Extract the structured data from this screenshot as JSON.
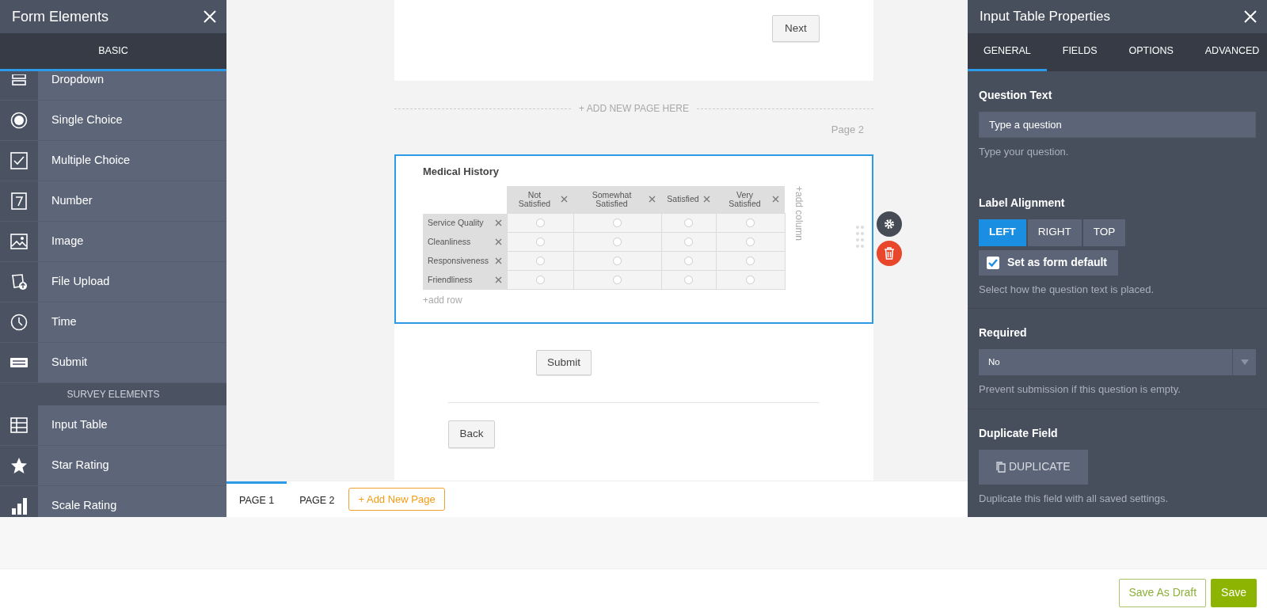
{
  "left_panel": {
    "title": "Form Elements",
    "tabs": [
      {
        "label": "BASIC",
        "selected": true
      }
    ],
    "sections": [
      {
        "items": [
          {
            "label": "Dropdown"
          },
          {
            "label": "Single Choice"
          },
          {
            "label": "Multiple Choice"
          },
          {
            "label": "Number"
          },
          {
            "label": "Image"
          },
          {
            "label": "File Upload"
          },
          {
            "label": "Time"
          },
          {
            "label": "Submit"
          }
        ]
      },
      {
        "title": "SURVEY ELEMENTS",
        "items": [
          {
            "label": "Input Table"
          },
          {
            "label": "Star Rating"
          },
          {
            "label": "Scale Rating"
          }
        ]
      }
    ]
  },
  "canvas": {
    "next_button": "Next",
    "add_page_here": "+ ADD NEW PAGE HERE",
    "page_label": "Page 2",
    "question": {
      "selected": true,
      "title": "Medical History",
      "columns": [
        "Not Satisfied",
        "Somewhat Satisfied",
        "Satisfied",
        "Very Satisfied"
      ],
      "rows": [
        {
          "label": "Service Quality",
          "cells": [
            {
              "selected": false
            },
            {
              "selected": false
            },
            {
              "selected": false
            },
            {
              "selected": false
            }
          ]
        },
        {
          "label": "Cleanliness",
          "cells": [
            {
              "selected": false
            },
            {
              "selected": false
            },
            {
              "selected": false
            },
            {
              "selected": false
            }
          ]
        },
        {
          "label": "Responsiveness",
          "cells": [
            {
              "selected": false
            },
            {
              "selected": false
            },
            {
              "selected": false
            },
            {
              "selected": false
            }
          ]
        },
        {
          "label": "Friendliness",
          "cells": [
            {
              "selected": false
            },
            {
              "selected": false
            },
            {
              "selected": false
            },
            {
              "selected": false
            }
          ]
        }
      ],
      "add_column": "+add column",
      "add_row": "+add row"
    },
    "submit_button": "Submit",
    "back_button": "Back",
    "page_tabs": [
      {
        "label": "PAGE 1",
        "selected": true
      },
      {
        "label": "PAGE 2",
        "selected": false
      }
    ],
    "add_page_button": "+ Add New Page"
  },
  "right_panel": {
    "title": "Input Table Properties",
    "tabs": [
      {
        "label": "GENERAL",
        "selected": true
      },
      {
        "label": "FIELDS",
        "selected": false
      },
      {
        "label": "OPTIONS",
        "selected": false
      },
      {
        "label": "ADVANCED",
        "selected": false
      }
    ],
    "question_text": {
      "label": "Question Text",
      "placeholder": "Type a question",
      "help": "Type your question."
    },
    "label_alignment": {
      "label": "Label Alignment",
      "options": [
        {
          "label": "LEFT",
          "selected": true
        },
        {
          "label": "RIGHT",
          "selected": false
        },
        {
          "label": "TOP",
          "selected": false
        }
      ],
      "form_default": {
        "label": "Set as form default",
        "checked": true
      },
      "help": "Select how the question text is placed."
    },
    "required": {
      "label": "Required",
      "value": "No",
      "help": "Prevent submission if this question is empty."
    },
    "duplicate": {
      "label": "Duplicate Field",
      "button": "DUPLICATE",
      "help": "Duplicate this field with all saved settings."
    }
  },
  "footer": {
    "save_draft_button": "Save As Draft",
    "save_button": "Save"
  }
}
